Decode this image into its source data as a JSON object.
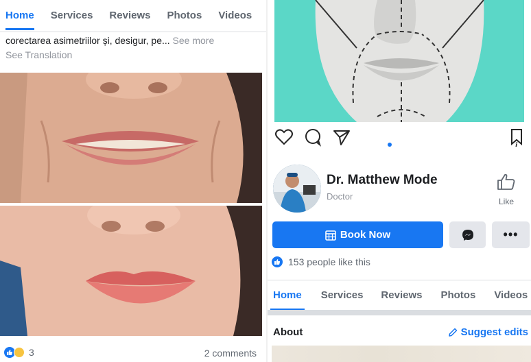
{
  "left": {
    "tabs": [
      {
        "label": "Home",
        "active": true
      },
      {
        "label": "Services",
        "active": false
      },
      {
        "label": "Reviews",
        "active": false
      },
      {
        "label": "Photos",
        "active": false
      },
      {
        "label": "Videos",
        "active": false
      }
    ],
    "post_text": "corectarea asimetriilor și, desigur, pe...",
    "see_more": "See more",
    "see_translation": "See Translation",
    "reaction_count": "3",
    "comments": "2 comments"
  },
  "right": {
    "doctor_name": "Dr. Matthew Mode",
    "doctor_category": "Doctor",
    "like_label": "Like",
    "book_now": "Book Now",
    "likes_text": "153 people like this",
    "tabs": [
      {
        "label": "Home",
        "active": true
      },
      {
        "label": "Services",
        "active": false
      },
      {
        "label": "Reviews",
        "active": false
      },
      {
        "label": "Photos",
        "active": false
      },
      {
        "label": "Videos",
        "active": false
      }
    ],
    "about": "About",
    "suggest_edits": "Suggest edits"
  },
  "colors": {
    "accent": "#1877f2",
    "insta_bg": "#5bd7c7"
  }
}
